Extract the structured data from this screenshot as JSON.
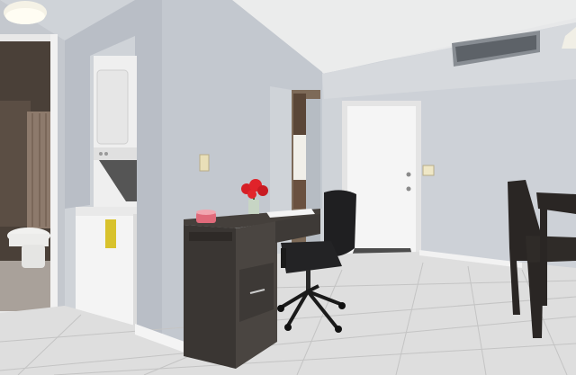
{
  "scene": {
    "palette": {
      "wall": "#c9cdd3",
      "wall_light": "#d8dce0",
      "ceiling": "#eceded",
      "floor": "#dcdcdc",
      "door": "#f2f2f2",
      "desk": "#3a3633",
      "chair": "#1c1c1e",
      "flowers": "#d61f26"
    },
    "objects": [
      "ceiling-light-icon",
      "bathroom-doorway",
      "toilet",
      "shower-curtain",
      "stacked-washer-dryer",
      "mini-fridge",
      "light-switch",
      "hallway-opening",
      "entry-door",
      "hvac-vent",
      "desk",
      "office-chair",
      "flower-vase",
      "candle",
      "dining-chair",
      "dining-table",
      "tile-floor"
    ]
  }
}
